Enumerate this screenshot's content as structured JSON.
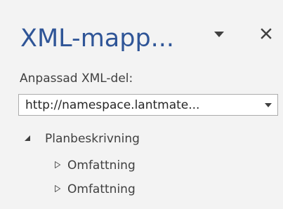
{
  "pane": {
    "title": "XML-mapp...",
    "options_icon": "dropdown-triangle-icon",
    "close_icon": "close-icon"
  },
  "part_selector": {
    "label": "Anpassad XML-del:",
    "value": "http://namespace.lantmate..."
  },
  "tree": {
    "items": [
      {
        "label": "Planbeskrivning",
        "expanded": true,
        "level": 0
      },
      {
        "label": "Omfattning",
        "expanded": false,
        "level": 1
      },
      {
        "label": "Omfattning",
        "expanded": false,
        "level": 1
      }
    ]
  },
  "colors": {
    "background": "#f3f3f3",
    "title": "#2f5597",
    "text": "#404040",
    "border": "#ababab"
  }
}
